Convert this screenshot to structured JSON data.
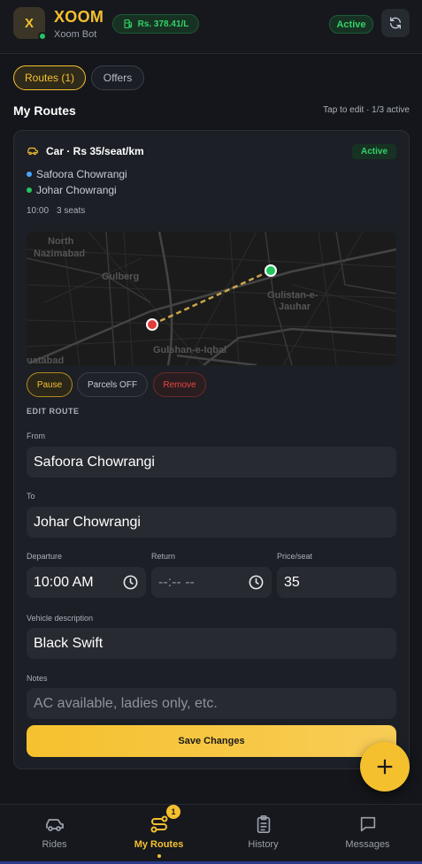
{
  "header": {
    "logo_letter": "X",
    "brand": "XOOM",
    "subtitle": "Xoom Bot",
    "fuel_price": "Rs. 378.41/L",
    "status": "Active"
  },
  "tabs": [
    {
      "label": "Routes (1)",
      "active": true
    },
    {
      "label": "Offers",
      "active": false
    }
  ],
  "section": {
    "title": "My Routes",
    "hint": "Tap to edit · 1/3 active"
  },
  "route_card": {
    "vehicle_line": "Car · Rs 35/seat/km",
    "status": "Active",
    "from_stop": "Safoora Chowrangi",
    "to_stop": "Johar Chowrangi",
    "time": "10:00",
    "seats": "3 seats",
    "map_labels": {
      "north": "North",
      "nazimabad": "Nazimabad",
      "gulberg": "Gulberg",
      "gulistan": "Gulistan-e-",
      "jauhar": "Jauhar",
      "gulshan": "Gulshan-e-Iqbal",
      "liaquatabad": "uatabad"
    },
    "actions": {
      "pause": "Pause",
      "parcels": "Parcels OFF",
      "remove": "Remove"
    }
  },
  "edit_form": {
    "heading": "EDIT ROUTE",
    "from_label": "From",
    "from_value": "Safoora Chowrangi",
    "to_label": "To",
    "to_value": "Johar Chowrangi",
    "departure_label": "Departure",
    "departure_value": "10:00 AM",
    "return_label": "Return",
    "return_placeholder": "--:-- --",
    "price_label": "Price/seat",
    "price_value": "35",
    "vehicle_label": "Vehicle description",
    "vehicle_value": "Black Swift",
    "notes_label": "Notes",
    "notes_placeholder": "AC available, ladies only, etc.",
    "save_label": "Save Changes"
  },
  "bottom_nav": {
    "items": [
      {
        "label": "Rides",
        "icon": "car-icon"
      },
      {
        "label": "My Routes",
        "icon": "route-icon",
        "badge": "1",
        "active": true
      },
      {
        "label": "History",
        "icon": "clipboard-icon"
      },
      {
        "label": "Messages",
        "icon": "chat-icon"
      }
    ]
  },
  "colors": {
    "accent": "#f5c02e",
    "success": "#34d06a",
    "danger": "#ef4444",
    "background": "#14161b",
    "card": "#1c1f25"
  }
}
